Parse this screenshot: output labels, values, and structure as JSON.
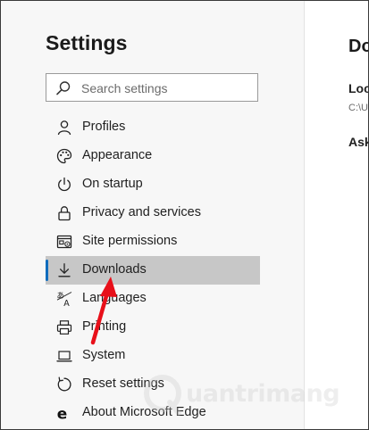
{
  "sidebar": {
    "title": "Settings",
    "search": {
      "placeholder": "Search settings",
      "icon": "search-icon"
    },
    "items": [
      {
        "label": "Profiles",
        "icon": "person-icon"
      },
      {
        "label": "Appearance",
        "icon": "palette-icon"
      },
      {
        "label": "On startup",
        "icon": "power-icon"
      },
      {
        "label": "Privacy and services",
        "icon": "lock-icon"
      },
      {
        "label": "Site permissions",
        "icon": "site-permissions-icon"
      },
      {
        "label": "Downloads",
        "icon": "download-icon",
        "selected": true
      },
      {
        "label": "Languages",
        "icon": "languages-icon"
      },
      {
        "label": "Printing",
        "icon": "printer-icon"
      },
      {
        "label": "System",
        "icon": "laptop-icon"
      },
      {
        "label": "Reset settings",
        "icon": "reset-icon"
      },
      {
        "label": "About Microsoft Edge",
        "icon": "edge-logo-icon"
      }
    ]
  },
  "main": {
    "heading": "Do",
    "location_label": "Loc",
    "location_path": "C:\\U",
    "ask_label": "Ask"
  },
  "watermark": {
    "text": "uantrimang"
  },
  "colors": {
    "accent": "#0f6cbd",
    "selected_bg": "#c7c7c7",
    "arrow": "#e8101a"
  }
}
